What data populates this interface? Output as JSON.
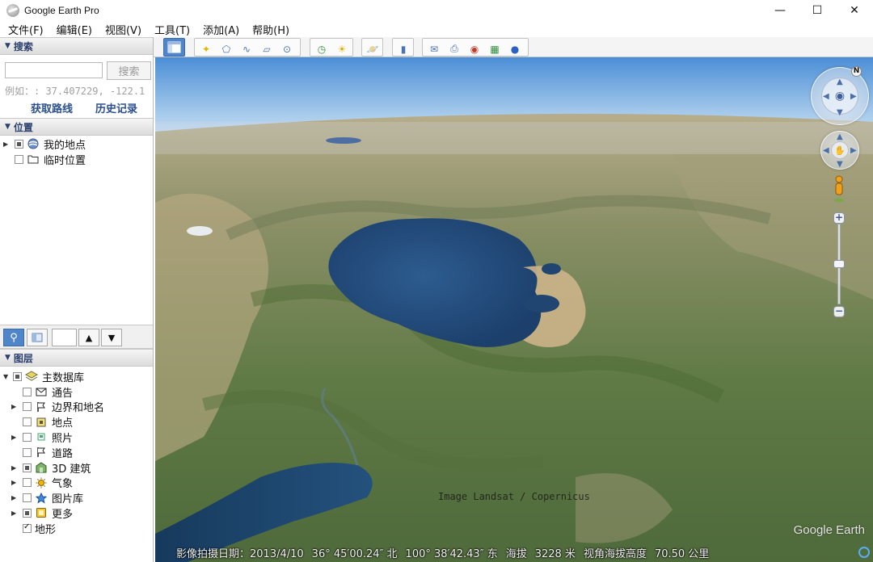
{
  "window": {
    "title": "Google Earth Pro",
    "minimize_glyph": "—",
    "maximize_glyph": "☐",
    "close_glyph": "✕"
  },
  "menu": [
    "文件(F)",
    "编辑(E)",
    "视图(V)",
    "工具(T)",
    "添加(A)",
    "帮助(H)"
  ],
  "search": {
    "header": "搜索",
    "input_value": "",
    "button_label": "搜索",
    "example": "例如：: 37.407229, -122.1",
    "get_route": "获取路线",
    "history": "历史记录"
  },
  "places": {
    "header": "位置",
    "items": [
      {
        "label": "我的地点",
        "icon": "globe-icon",
        "state": "partial",
        "expandable": true
      },
      {
        "label": "临时位置",
        "icon": "folder-icon",
        "state": "unchecked",
        "expandable": false
      }
    ]
  },
  "layers": {
    "header": "图层",
    "root": {
      "label": "主数据库",
      "icon": "layers-icon",
      "state": "partial"
    },
    "items": [
      {
        "label": "通告",
        "icon": "mail-icon",
        "state": "unchecked",
        "expandable": false
      },
      {
        "label": "边界和地名",
        "icon": "flag-icon",
        "state": "unchecked",
        "expandable": true
      },
      {
        "label": "地点",
        "icon": "placemark-icon",
        "state": "unchecked",
        "expandable": false
      },
      {
        "label": "照片",
        "icon": "photo-icon",
        "state": "unchecked",
        "expandable": true
      },
      {
        "label": "道路",
        "icon": "road-icon",
        "state": "unchecked",
        "expandable": false
      },
      {
        "label": "3D 建筑",
        "icon": "building-icon",
        "state": "partial",
        "expandable": true
      },
      {
        "label": "气象",
        "icon": "weather-icon",
        "state": "unchecked",
        "expandable": true
      },
      {
        "label": "图片库",
        "icon": "gallery-icon",
        "state": "unchecked",
        "expandable": true
      },
      {
        "label": "更多",
        "icon": "more-icon",
        "state": "partial",
        "expandable": true
      },
      {
        "label": "地形",
        "icon": "",
        "state": "checked",
        "expandable": false
      }
    ]
  },
  "toolbar": {
    "icons": [
      "sidebar-toggle-icon",
      "placemark-add-icon",
      "polygon-add-icon",
      "path-add-icon",
      "image-overlay-icon",
      "tour-record-icon",
      "historical-imagery-icon",
      "sunlight-icon",
      "planet-switch-icon",
      "ruler-icon",
      "email-icon",
      "print-icon",
      "save-image-icon",
      "map-view-icon",
      "earth-icon"
    ]
  },
  "map": {
    "imagery_credit": "Image Landsat / Copernicus",
    "logo": "Google Earth",
    "status": {
      "imagery_date": "影像拍摄日期：2013/4/10",
      "lat": "36° 45′00.24″ 北",
      "lon": "100° 38′42.43″ 东",
      "elevation_label": "海拔",
      "elevation_value": "3228 米",
      "eye_alt_label": "视角海拔高度",
      "eye_alt_value": "70.50 公里"
    },
    "north_glyph": "N"
  }
}
